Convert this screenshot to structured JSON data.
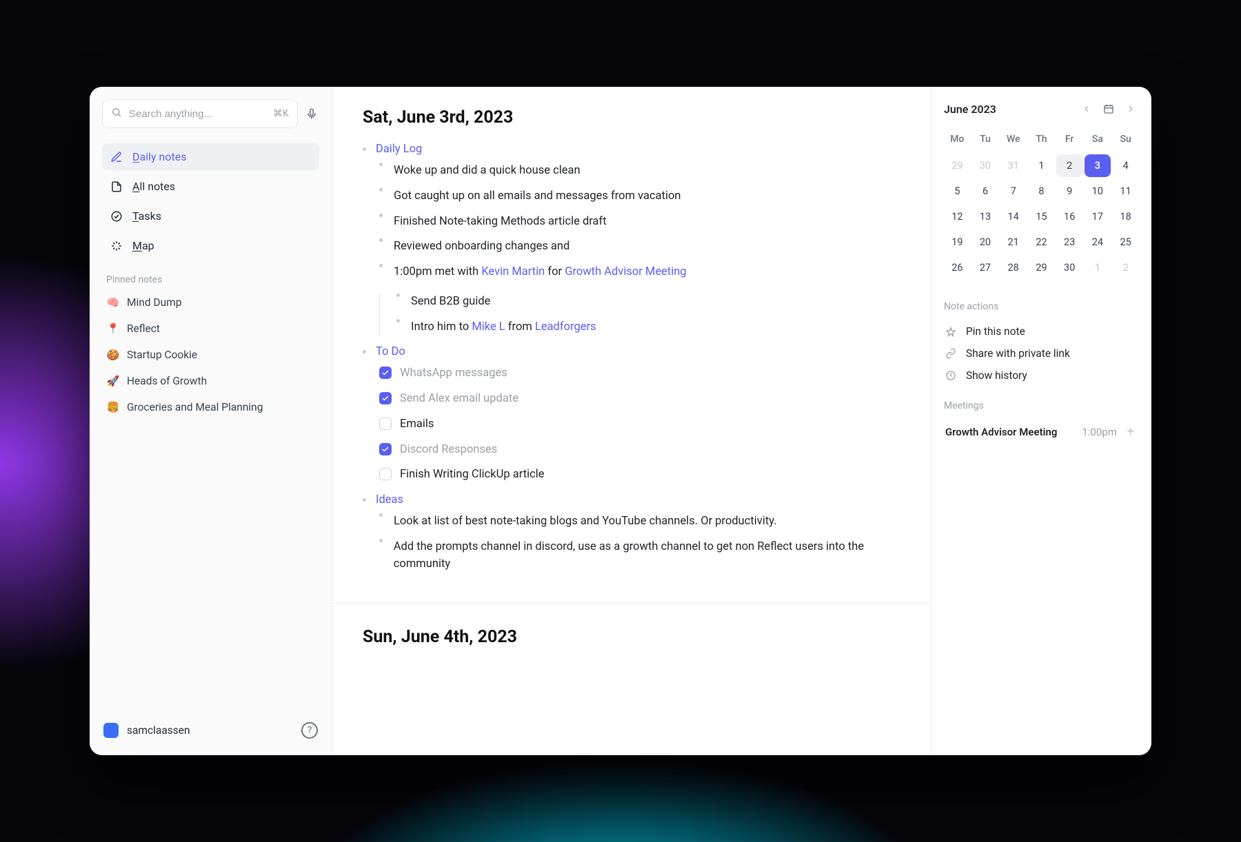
{
  "sidebar": {
    "search": {
      "placeholder": "Search anything...",
      "shortcut": "⌘K"
    },
    "nav": [
      {
        "id": "daily-notes",
        "label": "Daily notes",
        "underline_first": "D",
        "rest": "aily notes",
        "active": true
      },
      {
        "id": "all-notes",
        "label": "All notes",
        "underline_first": "A",
        "rest": "ll notes",
        "active": false
      },
      {
        "id": "tasks",
        "label": "Tasks",
        "underline_first": "T",
        "rest": "asks",
        "active": false
      },
      {
        "id": "map",
        "label": "Map",
        "underline_first": "M",
        "rest": "ap",
        "active": false
      }
    ],
    "pinned_header": "Pinned notes",
    "pinned": [
      {
        "emoji": "🧠",
        "label": "Mind Dump"
      },
      {
        "emoji": "📍",
        "label": "Reflect"
      },
      {
        "emoji": "🍪",
        "label": "Startup Cookie"
      },
      {
        "emoji": "🚀",
        "label": "Heads of Growth"
      },
      {
        "emoji": "🍔",
        "label": "Groceries and Meal Planning"
      }
    ],
    "user": "samclaassen"
  },
  "main": {
    "title": "Sat, June 3rd, 2023",
    "sections": {
      "daily_log": {
        "heading": "Daily Log",
        "items": [
          "Woke up and did a quick house clean",
          "Got caught up on all emails and messages from vacation",
          "Finished Note-taking Methods article draft",
          "Reviewed onboarding changes and"
        ],
        "meeting": {
          "time": "1:00pm",
          "verb": "met with",
          "person": "Kevin Martin",
          "for": "for",
          "event": "Growth Advisor Meeting",
          "subitems": [
            {
              "text": "Send B2B guide"
            },
            {
              "prefix": "Intro him to ",
              "mention": "Mike L",
              "middle": " from ",
              "mention2": "Leadforgers"
            }
          ]
        }
      },
      "todo": {
        "heading": "To Do",
        "items": [
          {
            "label": "WhatsApp messages",
            "checked": true
          },
          {
            "label": "Send Alex email update",
            "checked": true
          },
          {
            "label": "Emails",
            "checked": false
          },
          {
            "label": "Discord Responses",
            "checked": true
          },
          {
            "label": "Finish Writing ClickUp article",
            "checked": false
          }
        ]
      },
      "ideas": {
        "heading": "Ideas",
        "items": [
          "Look at list of best note-taking blogs and YouTube channels. Or productivity.",
          "Add the prompts channel in discord, use as a growth channel to get non Reflect users into the community"
        ]
      }
    },
    "next_title": "Sun, June 4th, 2023"
  },
  "right": {
    "calendar": {
      "title": "June 2023",
      "dow": [
        "Mo",
        "Tu",
        "We",
        "Th",
        "Fr",
        "Sa",
        "Su"
      ],
      "weeks": [
        [
          {
            "d": "29",
            "muted": true
          },
          {
            "d": "30",
            "muted": true
          },
          {
            "d": "31",
            "muted": true
          },
          {
            "d": "1"
          },
          {
            "d": "2",
            "highlight": true
          },
          {
            "d": "3",
            "selected": true
          },
          {
            "d": "4"
          }
        ],
        [
          {
            "d": "5"
          },
          {
            "d": "6"
          },
          {
            "d": "7"
          },
          {
            "d": "8"
          },
          {
            "d": "9"
          },
          {
            "d": "10"
          },
          {
            "d": "11"
          }
        ],
        [
          {
            "d": "12"
          },
          {
            "d": "13"
          },
          {
            "d": "14"
          },
          {
            "d": "15"
          },
          {
            "d": "16"
          },
          {
            "d": "17"
          },
          {
            "d": "18"
          }
        ],
        [
          {
            "d": "19"
          },
          {
            "d": "20"
          },
          {
            "d": "21"
          },
          {
            "d": "22"
          },
          {
            "d": "23"
          },
          {
            "d": "24"
          },
          {
            "d": "25"
          }
        ],
        [
          {
            "d": "26"
          },
          {
            "d": "27"
          },
          {
            "d": "28"
          },
          {
            "d": "29"
          },
          {
            "d": "30"
          },
          {
            "d": "1",
            "muted": true
          },
          {
            "d": "2",
            "muted": true
          }
        ]
      ]
    },
    "note_actions_header": "Note actions",
    "actions": {
      "pin": "Pin this note",
      "share": "Share with private link",
      "history": "Show history"
    },
    "meetings_header": "Meetings",
    "meetings": [
      {
        "title": "Growth Advisor Meeting",
        "time": "1:00pm"
      }
    ]
  }
}
